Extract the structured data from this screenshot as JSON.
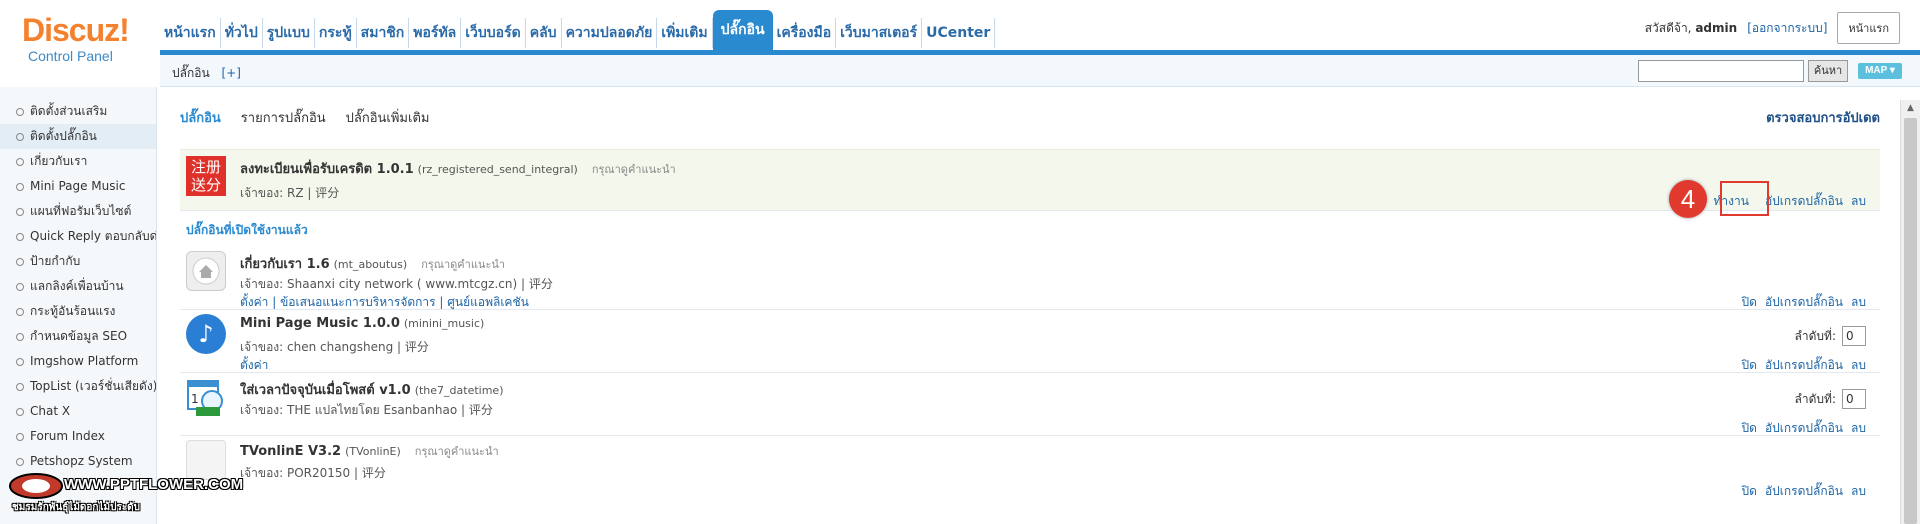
{
  "logo": {
    "brand": "Discuz!",
    "subtitle": "Control Panel"
  },
  "nav": {
    "items": [
      "หน้าแรก",
      "ทั่วไป",
      "รูปแบบ",
      "กระทู้",
      "สมาชิก",
      "พอร์ทัล",
      "เว็บบอร์ด",
      "คลับ",
      "ความปลอดภัย",
      "เพิ่มเติม",
      "ปลั๊กอิน",
      "เครื่องมือ",
      "เว็บมาสเตอร์",
      "UCenter"
    ],
    "active_index": 10
  },
  "user": {
    "greeting": "สวัสดีจ้า,",
    "name": "admin",
    "logout": "[ออกจากระบบ]",
    "home_button": "หน้าแรก"
  },
  "subbar": {
    "crumb": "ปลั๊กอิน",
    "add": "[+]",
    "search_value": "",
    "search_button": "ค้นหา",
    "map_button": "MAP"
  },
  "sidebar": {
    "items": [
      "ติดตั้งส่วนเสริม",
      "ติดตั้งปลั๊กอิน",
      "เกี่ยวกับเรา",
      "Mini Page Music",
      "แผนที่ฟอรัมเว็บไซต์",
      "Quick Reply ตอบกลับด่",
      "ป้ายกำกับ",
      "แลกลิงค์เพื่อนบ้าน",
      "กระทู้อันร้อนแรง",
      "กำหนดข้อมูล SEO",
      "Imgshow Platform",
      "TopList (เวอร์ชั่นเสียดัง)",
      "Chat X",
      "Forum Index",
      "Petshopz System"
    ],
    "active_index": 1
  },
  "tabs": {
    "items": [
      "ปลั๊กอิน",
      "รายการปลั๊กอิน",
      "ปลั๊กอินเพิ่มเติม"
    ],
    "active_index": 0,
    "check_update": "ตรวจสอบการอัปเดต"
  },
  "pending": {
    "title": "ลงทะเบียนเพื่อรับเครดิต 1.0.1",
    "id": "(rz_registered_send_integral)",
    "hint": "กรุณาดูคำแนะนำ",
    "owner": "เจ้าของ: RZ | 评分",
    "icon_text": [
      "注册",
      "送分"
    ],
    "actions": [
      "ทำงาน",
      "อัปเกรดปลั๊กอิน",
      "ลบ"
    ]
  },
  "section_title": "ปลั๊กอินที่เปิดใช้งานแล้ว",
  "annotation": {
    "step": "4",
    "color": "#e03a2f"
  },
  "plugins": [
    {
      "title": "เกี่ยวกับเรา 1.6",
      "id": "(mt_aboutus)",
      "hint": "กรุณาดูคำแนะนำ",
      "owner": "เจ้าของ: Shaanxi city network ( www.mtcgz.cn)  | 评分",
      "setting": "ตั้งค่า | ข้อเสนอแนะการบริหารจัดการ | ศูนย์แอพลิเคชัน",
      "actions": [
        "ปิด",
        "อัปเกรดปลั๊กอิน",
        "ลบ"
      ],
      "order_label": "",
      "order_value": "",
      "icon": "home-icon"
    },
    {
      "title": "Mini Page Music 1.0.0",
      "id": "(minini_music)",
      "hint": "",
      "owner": "เจ้าของ: chen changsheng | 评分",
      "setting": "ตั้งค่า",
      "actions": [
        "ปิด",
        "อัปเกรดปลั๊กอิน",
        "ลบ"
      ],
      "order_label": "ลำดับที่:",
      "order_value": "0",
      "icon": "music-note-icon"
    },
    {
      "title": "ใส่เวลาปัจจุบันเมื่อโพสต์ v1.0",
      "id": "(the7_datetime)",
      "hint": "",
      "owner": "เจ้าของ: THE แปลไทยโดย Esanbanhao | 评分",
      "setting": "",
      "actions": [
        "ปิด",
        "อัปเกรดปลั๊กอิน",
        "ลบ"
      ],
      "order_label": "ลำดับที่:",
      "order_value": "0",
      "icon": "calendar-clock-icon"
    },
    {
      "title": "TVonlinE V3.2",
      "id": "(TVonlinE)",
      "hint": "กรุณาดูคำแนะนำ",
      "owner": "เจ้าของ: POR20150 | 评分",
      "setting": "",
      "actions": [
        "ปิด",
        "อัปเกรดปลั๊กอิน",
        "ลบ"
      ],
      "order_label": "",
      "order_value": "",
      "icon": "blank-plugin-icon"
    }
  ],
  "watermark": {
    "line1": "WWW.PPTFLOWER.COM",
    "line2": "ชมรมรักพันธุ์ไม้ดอกไม้ประดับ"
  }
}
